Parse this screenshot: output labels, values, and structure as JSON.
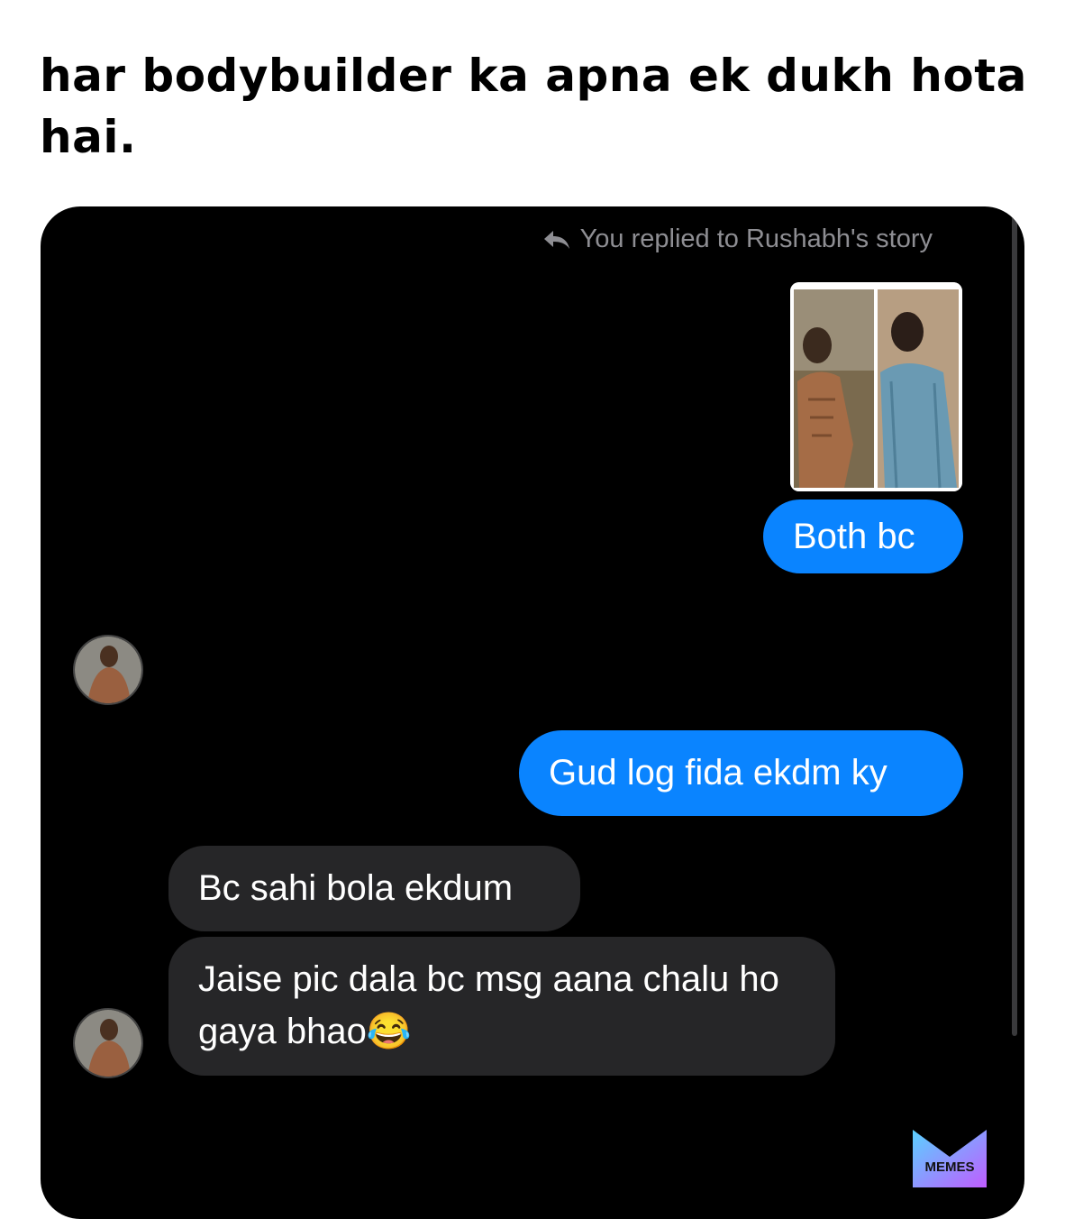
{
  "caption": "har bodybuilder ka apna ek dukh hota hai.",
  "chat": {
    "story_reply_label": "You replied to Rushabh's story",
    "messages": [
      {
        "from": "me",
        "text": "Both bc"
      },
      {
        "from": "them",
        "text": "😂😂😂"
      },
      {
        "from": "me",
        "text": "Gud log fida ekdm ky"
      },
      {
        "from": "them",
        "text": "Bc sahi bola ekdum"
      },
      {
        "from": "them",
        "text": "Jaise pic dala bc msg aana chalu ho gaya bhao😂"
      },
      {
        "from": "me",
        "text": "😂😂😂"
      }
    ]
  },
  "watermark": {
    "text": "MEMES"
  },
  "colors": {
    "outgoing_bubble": "#0a84ff",
    "incoming_bubble": "#262628",
    "background": "#000000"
  }
}
